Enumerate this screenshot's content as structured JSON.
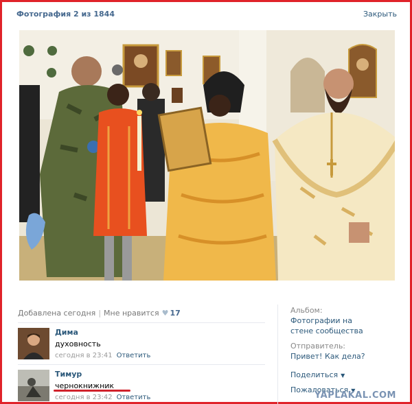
{
  "header": {
    "title": "Фотография 2 из 1844",
    "close_label": "Закрыть"
  },
  "photo": {
    "alt_subject": "photo-of-orthodox-clergy-and-soldier"
  },
  "meta": {
    "added": "Добавлена сегодня",
    "like_label": "Мне нравится",
    "like_count": "17"
  },
  "comments": [
    {
      "name": "Дима",
      "text": "духовность",
      "time": "сегодня в 23:41",
      "reply": "Ответить"
    },
    {
      "name": "Тимур",
      "text": "чернокнижник",
      "time": "сегодня в 23:42",
      "reply": "Ответить"
    }
  ],
  "sidebar": {
    "album_label": "Альбом:",
    "album_name": "Фотографии на стене сообщества",
    "sender_label": "Отправитель:",
    "sender_name": "Привет! Как дела?",
    "share_label": "Поделиться",
    "actions_label": "Пожаловаться"
  },
  "watermark": "YAPLAKAL.COM",
  "colors": {
    "frame": "#e0232a",
    "link": "#2b587a",
    "title": "#45688e"
  }
}
